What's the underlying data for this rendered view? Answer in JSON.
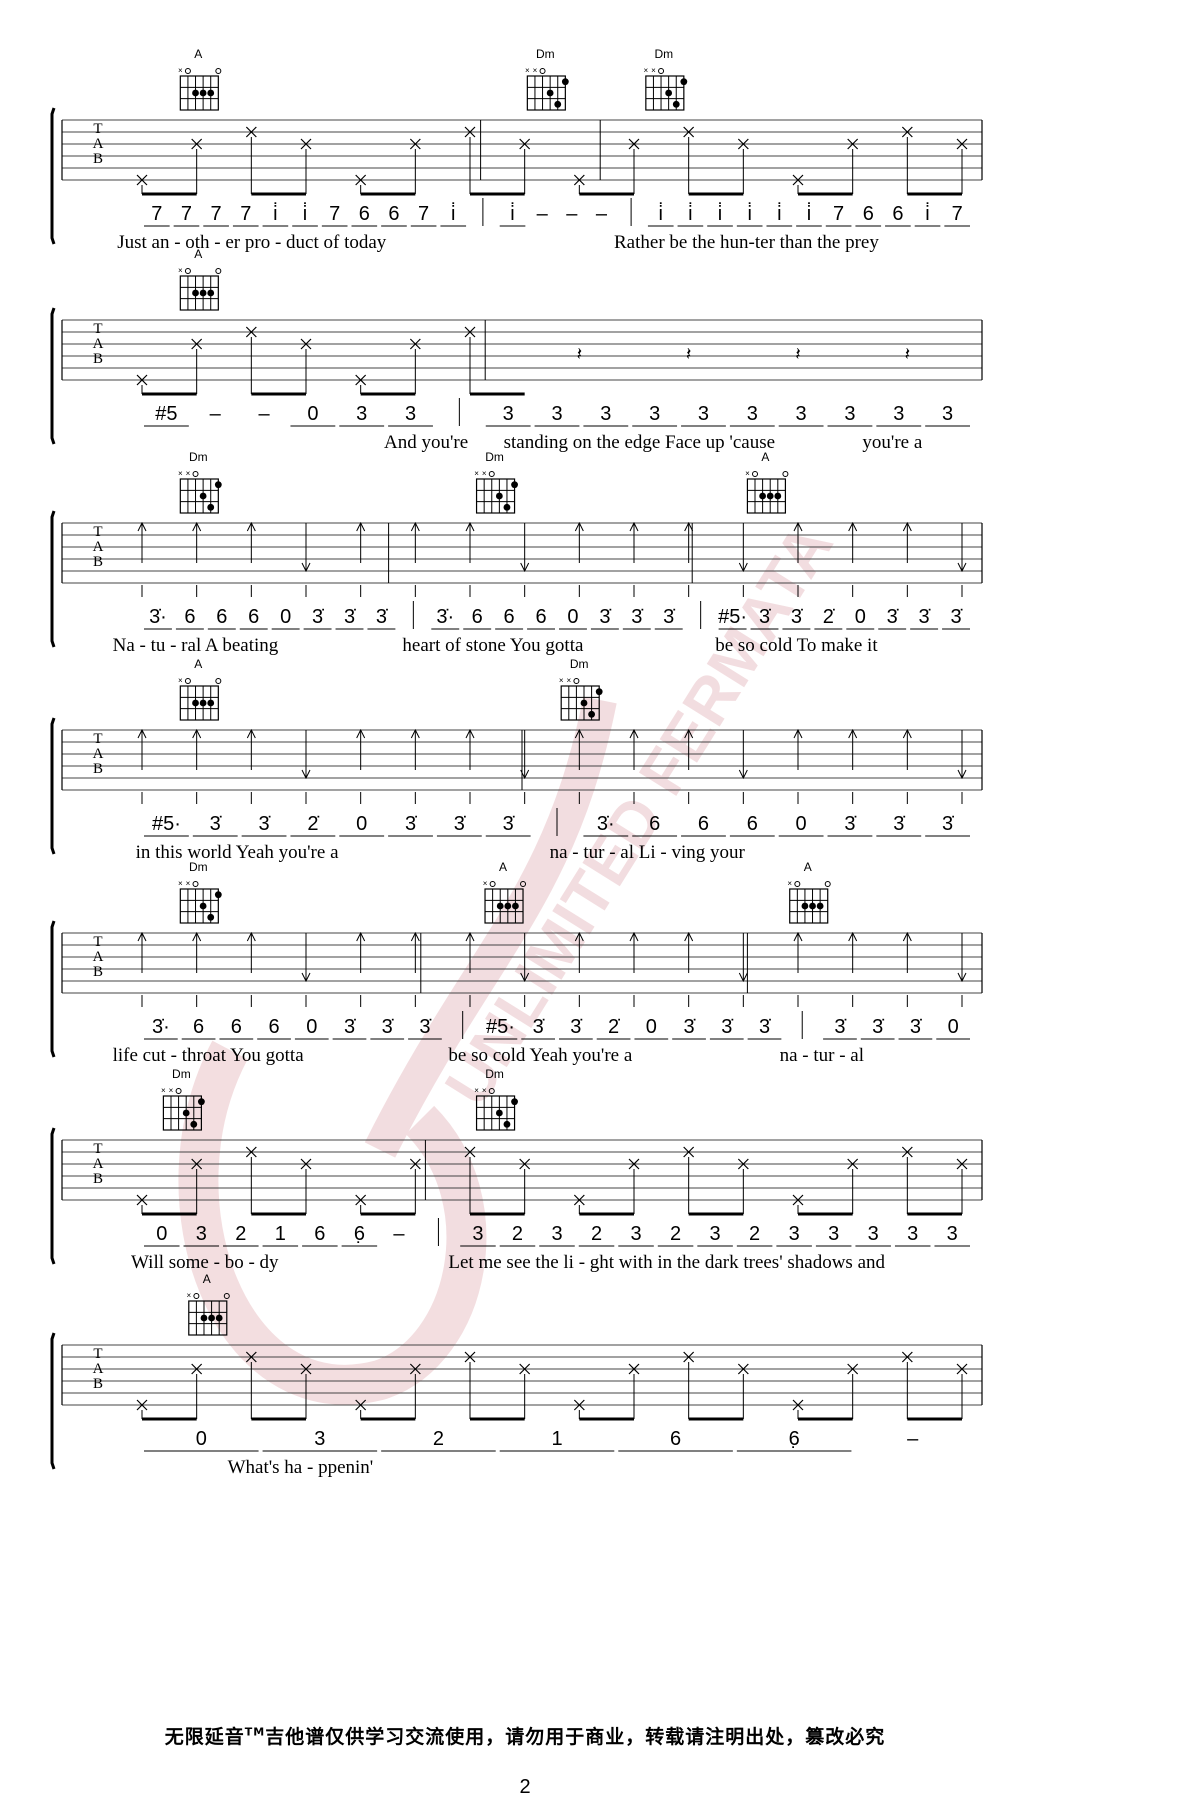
{
  "document": {
    "type": "guitar-tab-sheet",
    "page_number": "2",
    "footer": {
      "brand": "无限延音",
      "trademark": "TM",
      "notice": "吉他谱仅供学习交流使用，请勿用于商业，转载请注明出处，篡改必究"
    },
    "watermark": {
      "text": "UNLIMITED FERMATA",
      "brand_cn": "无限延音",
      "color": "#e9c3c7"
    }
  },
  "tab_labels": [
    "T",
    "A",
    "B"
  ],
  "chords": {
    "A": {
      "name": "A",
      "markers": [
        "x",
        "o",
        "",
        "",
        "",
        "o"
      ],
      "dots": [
        [
          3,
          2
        ],
        [
          4,
          2
        ],
        [
          5,
          2
        ]
      ]
    },
    "Dm": {
      "name": "Dm",
      "markers": [
        "x",
        "x",
        "o",
        "",
        "",
        ""
      ],
      "dots": [
        [
          6,
          1
        ],
        [
          5,
          3
        ],
        [
          4,
          2
        ]
      ]
    }
  },
  "systems": [
    {
      "chord_marks": [
        {
          "chord": "A",
          "beat": 0.05
        },
        {
          "chord": "Dm",
          "beat": 0.46
        },
        {
          "chord": "Dm",
          "beat": 0.6
        }
      ],
      "bars": [
        0.455,
        0.585
      ],
      "strum": "arpeggio",
      "notation": [
        "7",
        "7",
        "7",
        "7",
        "i̇",
        "i̇",
        "7",
        "6",
        "6",
        "7",
        "i̇",
        "|",
        "i̇",
        "–",
        "–",
        "–",
        "|",
        "i̇",
        "i̇",
        "i̇",
        "i̇",
        "i̇",
        "i̇",
        "7",
        "6",
        "6",
        "i̇",
        "7"
      ],
      "lyrics": [
        {
          "text": "Just an - oth - er pro - duct of  today",
          "pos": 0.06
        },
        {
          "text": "Rather  be the hun-ter   than    the prey",
          "pos": 0.6
        }
      ]
    },
    {
      "chord_marks": [
        {
          "chord": "A",
          "beat": 0.05
        }
      ],
      "bars": [
        0.46
      ],
      "strum": "arpeggio-rest",
      "notation": [
        "#5",
        "–",
        "–",
        "0",
        "3",
        "3",
        "|",
        "3",
        "3",
        "3",
        "3",
        "3",
        "3",
        "3",
        "3",
        "3",
        "3"
      ],
      "lyrics": [
        {
          "text": "And you're",
          "pos": 0.35
        },
        {
          "text": "standing  on  the edge Face up 'cause",
          "pos": 0.48
        },
        {
          "text": "you're a",
          "pos": 0.87
        }
      ]
    },
    {
      "chord_marks": [
        {
          "chord": "Dm",
          "beat": 0.05
        },
        {
          "chord": "Dm",
          "beat": 0.4
        },
        {
          "chord": "A",
          "beat": 0.72
        }
      ],
      "bars": [
        0.355,
        0.685
      ],
      "strum": "strum",
      "notation": [
        "3̇·",
        "6",
        "6",
        "6",
        "0",
        "3̇",
        "3̇",
        "3̇",
        "|",
        "3̇·",
        "6",
        "6",
        "6",
        "0",
        "3̇",
        "3̇",
        "3̇",
        "|",
        "#5·",
        "3̇",
        "3̇",
        "2̇",
        "0",
        "3̇",
        "3̇",
        "3̇"
      ],
      "lyrics": [
        {
          "text": "Na - tu - ral      A  beating",
          "pos": 0.055
        },
        {
          "text": "heart of    stone  You  gotta",
          "pos": 0.37
        },
        {
          "text": "be  so  cold    To make it",
          "pos": 0.71
        }
      ]
    },
    {
      "chord_marks": [
        {
          "chord": "A",
          "beat": 0.05
        },
        {
          "chord": "Dm",
          "beat": 0.5
        }
      ],
      "bars": [
        0.5
      ],
      "strum": "strum",
      "notation": [
        "#5·",
        "3̇",
        "3̇",
        "2̇",
        "0",
        "3̇",
        "3̇",
        "3̇",
        "|",
        "3̇·",
        "6",
        "6",
        "6",
        "0",
        "3̇",
        "3̇",
        "3̇"
      ],
      "lyrics": [
        {
          "text": "in     this     world      Yeah  you're a",
          "pos": 0.08
        },
        {
          "text": "na - tur  -  al        Li - ving  your",
          "pos": 0.53
        }
      ]
    },
    {
      "chord_marks": [
        {
          "chord": "Dm",
          "beat": 0.05
        },
        {
          "chord": "A",
          "beat": 0.41
        },
        {
          "chord": "A",
          "beat": 0.77
        }
      ],
      "bars": [
        0.39,
        0.745
      ],
      "strum": "strum-end-rest",
      "notation": [
        "3̇·",
        "6",
        "6",
        "6",
        "0",
        "3̇",
        "3̇",
        "3̇",
        "|",
        "#5·",
        "3̇",
        "3̇",
        "2̇",
        "0",
        "3̇",
        "3̇",
        "3̇",
        "|",
        "3̇",
        "3̇",
        "3̇",
        "0"
      ],
      "lyrics": [
        {
          "text": "life  cut - throat      You   gotta",
          "pos": 0.055
        },
        {
          "text": "be   so   cold     Yeah  you're a",
          "pos": 0.42
        },
        {
          "text": "na  -  tur  -  al",
          "pos": 0.78
        }
      ]
    },
    {
      "chord_marks": [
        {
          "chord": "Dm",
          "beat": 0.03
        },
        {
          "chord": "Dm",
          "beat": 0.4
        }
      ],
      "bars": [
        0.395
      ],
      "strum": "arpeggio-dm",
      "notation": [
        "0",
        "3",
        "2",
        "1",
        "6",
        "6̣",
        "–",
        "|",
        "3",
        "2",
        "3",
        "2",
        "3",
        "2",
        "3",
        "2",
        "3",
        "3",
        "3",
        "3",
        "3"
      ],
      "lyrics": [
        {
          "text": "Will  some - bo - dy",
          "pos": 0.075
        },
        {
          "text": "Let me see the  li - ght with in  the dark    trees' shadows and",
          "pos": 0.42
        }
      ]
    },
    {
      "chord_marks": [
        {
          "chord": "A",
          "beat": 0.06
        }
      ],
      "bars": [],
      "strum": "arpeggio-final",
      "notation": [
        "0",
        "3",
        "2",
        "1",
        "6",
        "6̣",
        "–"
      ],
      "lyrics": [
        {
          "text": "What's      ha    -    ppenin'",
          "pos": 0.18
        }
      ]
    }
  ]
}
